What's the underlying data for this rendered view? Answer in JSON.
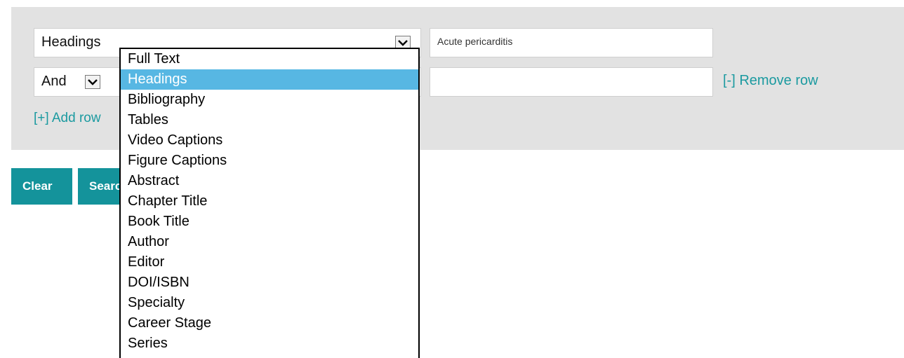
{
  "search_form": {
    "row1": {
      "field_select": "Headings",
      "search_value": "Acute pericarditis"
    },
    "row2": {
      "operator_select": "And",
      "search_value": "",
      "remove_label": "[-] Remove row"
    },
    "add_row_label": "[+] Add row"
  },
  "buttons": {
    "clear_label": "Clear",
    "search_label": "Search"
  },
  "dropdown": {
    "selected": "Headings",
    "options": [
      "Full Text",
      "Headings",
      "Bibliography",
      "Tables",
      "Video Captions",
      "Figure Captions",
      "Abstract",
      "Chapter Title",
      "Book Title",
      "Author",
      "Editor",
      "DOI/ISBN",
      "Specialty",
      "Career Stage",
      "Series"
    ]
  },
  "colors": {
    "accent": "#14939b",
    "link": "#1b9aa0",
    "highlight": "#57b7e3",
    "panel": "#e2e2e2"
  }
}
